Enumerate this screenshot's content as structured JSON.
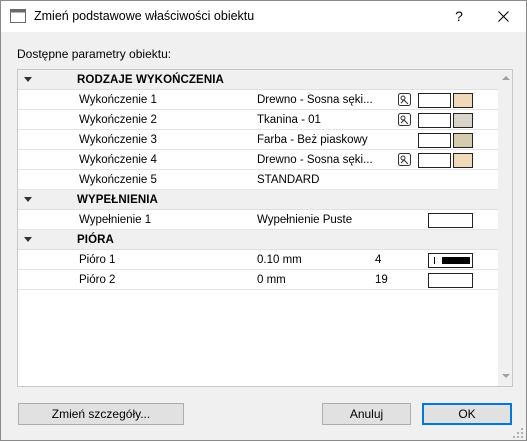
{
  "window": {
    "title": "Zmień podstawowe właściwości obiektu",
    "help_label": "?"
  },
  "params_label": "Dostępne parametry obiektu:",
  "groups": [
    {
      "name": "RODZAJE WYKOŃCZENIA",
      "rows": [
        {
          "name": "Wykończenie 1",
          "value": "Drewno - Sosna sęki...",
          "picker": true,
          "swatch_color": "#efd9b9"
        },
        {
          "name": "Wykończenie 2",
          "value": "Tkanina - 01",
          "picker": true,
          "swatch_color": "#d9d4ca"
        },
        {
          "name": "Wykończenie 3",
          "value": "Farba - Beż piaskowy",
          "picker": false,
          "swatch_color": "#d4ccac"
        },
        {
          "name": "Wykończenie 4",
          "value": "Drewno - Sosna sęki...",
          "picker": true,
          "swatch_color": "#efd9b9"
        },
        {
          "name": "Wykończenie 5",
          "value": "STANDARD",
          "picker": false,
          "swatch_color": ""
        }
      ]
    },
    {
      "name": "WYPEŁNIENIA",
      "rows": [
        {
          "name": "Wypełnienie 1",
          "value": "Wypełnienie Puste"
        }
      ]
    },
    {
      "name": "PIÓRA",
      "rows": [
        {
          "name": "Pióro 1",
          "value": "0.10 mm",
          "number": "4"
        },
        {
          "name": "Pióro 2",
          "value": "0 mm",
          "number": "19"
        }
      ]
    }
  ],
  "buttons": {
    "change_details": "Zmień szczegóły...",
    "cancel": "Anuluj",
    "ok": "OK"
  },
  "colors": {
    "accent": "#0078d7",
    "group_bg": "#f0f0f0"
  }
}
